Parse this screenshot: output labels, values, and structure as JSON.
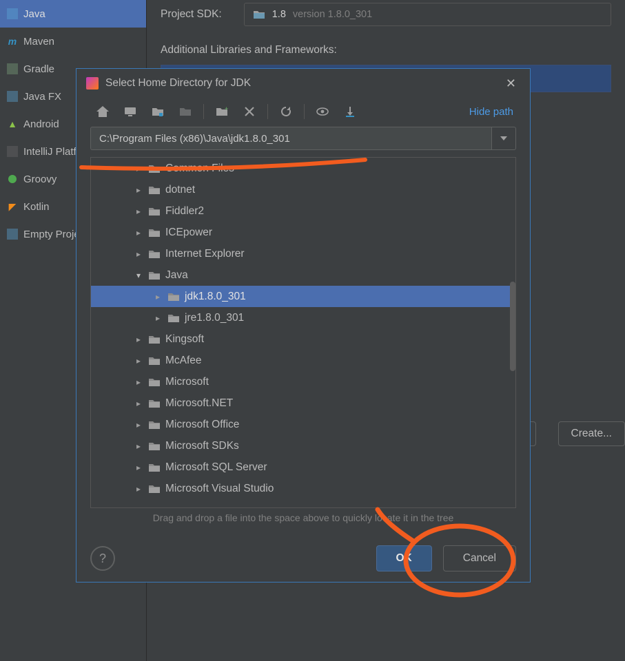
{
  "sidebar": {
    "items": [
      {
        "label": "Java",
        "selected": true
      },
      {
        "label": "Maven"
      },
      {
        "label": "Gradle"
      },
      {
        "label": "Java FX"
      },
      {
        "label": "Android"
      },
      {
        "label": "IntelliJ Platform Plugin"
      },
      {
        "label": "Groovy"
      },
      {
        "label": "Kotlin"
      },
      {
        "label": "Empty Project"
      }
    ]
  },
  "rightpanel": {
    "sdk_label": "Project SDK:",
    "sdk_value_prefix": "1.8",
    "sdk_value_suffix": "version 1.8.0_301",
    "libs_label": "Additional Libraries and Frameworks:",
    "create_label": "Create..."
  },
  "dialog": {
    "title": "Select Home Directory for JDK",
    "hide_path": "Hide path",
    "path_value": "C:\\Program Files (x86)\\Java\\jdk1.8.0_301",
    "hint": "Drag and drop a file into the space above to quickly locate it in the tree",
    "ok": "OK",
    "cancel": "Cancel",
    "tree": [
      {
        "label": "Common Files",
        "indent": 0,
        "expandable": true,
        "expanded": false
      },
      {
        "label": "dotnet",
        "indent": 0,
        "expandable": true,
        "expanded": false
      },
      {
        "label": "Fiddler2",
        "indent": 0,
        "expandable": true,
        "expanded": false
      },
      {
        "label": "ICEpower",
        "indent": 0,
        "expandable": true,
        "expanded": false
      },
      {
        "label": "Internet Explorer",
        "indent": 0,
        "expandable": true,
        "expanded": false
      },
      {
        "label": "Java",
        "indent": 0,
        "expandable": true,
        "expanded": true
      },
      {
        "label": "jdk1.8.0_301",
        "indent": 1,
        "expandable": true,
        "expanded": false,
        "selected": true
      },
      {
        "label": "jre1.8.0_301",
        "indent": 1,
        "expandable": true,
        "expanded": false
      },
      {
        "label": "Kingsoft",
        "indent": 0,
        "expandable": true,
        "expanded": false
      },
      {
        "label": "McAfee",
        "indent": 0,
        "expandable": true,
        "expanded": false
      },
      {
        "label": "Microsoft",
        "indent": 0,
        "expandable": true,
        "expanded": false
      },
      {
        "label": "Microsoft.NET",
        "indent": 0,
        "expandable": true,
        "expanded": false
      },
      {
        "label": "Microsoft Office",
        "indent": 0,
        "expandable": true,
        "expanded": false
      },
      {
        "label": "Microsoft SDKs",
        "indent": 0,
        "expandable": true,
        "expanded": false
      },
      {
        "label": "Microsoft SQL Server",
        "indent": 0,
        "expandable": true,
        "expanded": false
      },
      {
        "label": "Microsoft Visual Studio",
        "indent": 0,
        "expandable": true,
        "expanded": false
      }
    ]
  }
}
